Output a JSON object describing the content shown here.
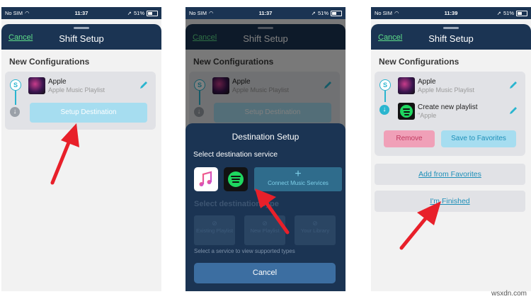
{
  "status_bars": [
    {
      "carrier": "No SIM",
      "time": "11:37",
      "battery": "51%"
    },
    {
      "carrier": "No SIM",
      "time": "11:37",
      "battery": "51%"
    },
    {
      "carrier": "No SIM",
      "time": "11:39",
      "battery": "51%"
    }
  ],
  "header": {
    "cancel_label": "Cancel",
    "title": "Shift Setup"
  },
  "section_title": "New Configurations",
  "source": {
    "title": "Apple",
    "subtitle": "Apple Music Playlist"
  },
  "screen1": {
    "setup_destination_label": "Setup Destination"
  },
  "screen2": {
    "dest_title": "Destination Setup",
    "dest_subtitle": "Select destination service",
    "connect_plus": "+",
    "connect_label": "Connect Music Services",
    "faded_type_title": "Select destination type",
    "type_buttons": [
      "Existing Playlist",
      "New Playlist",
      "Your Library"
    ],
    "hint": "Select a service to view supported types",
    "cancel_label": "Cancel"
  },
  "screen3": {
    "dest_title": "Create new playlist",
    "dest_subtitle": "\"Apple",
    "remove_label": "Remove",
    "save_label": "Save to Favorites",
    "add_fav_label": "Add from Favorites",
    "finished_label": "I'm Finished"
  },
  "watermark": "wsxdn.com",
  "colors": {
    "header_bg": "#1b3453",
    "accent_green": "#5fe08a",
    "accent_teal": "#2ab5cf",
    "setup_button": "#a6ddf0",
    "remove_button": "#f0a0b8",
    "save_button": "#a6ddf0",
    "link_blue": "#1d8fb8",
    "arrow_red": "#e8202a",
    "spotify_green": "#1ed760"
  }
}
